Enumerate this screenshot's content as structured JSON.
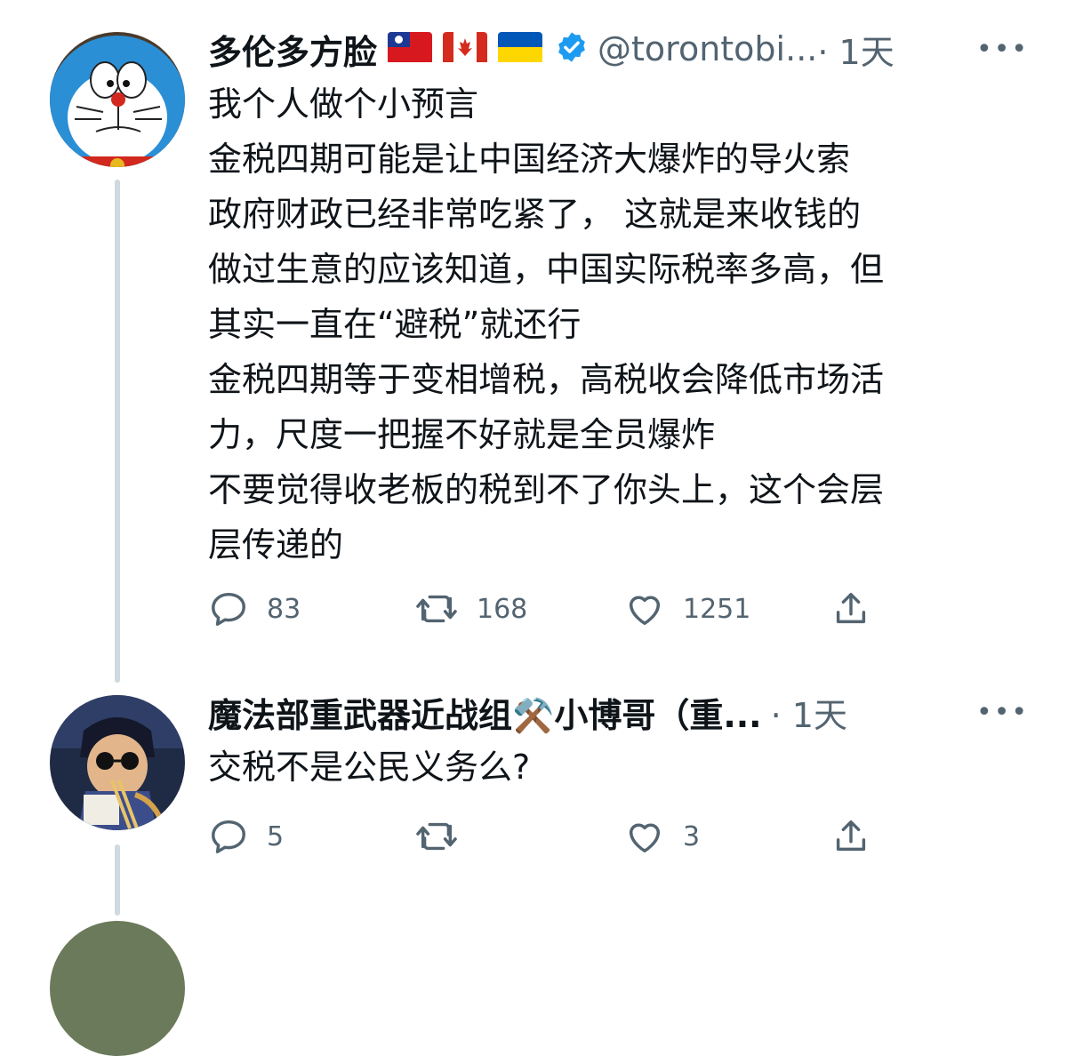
{
  "tweets": [
    {
      "author_name": "多伦多方脸",
      "flags": [
        "taiwan-flag",
        "canada-flag",
        "ukraine-flag"
      ],
      "verified": true,
      "handle": "@torontobi...",
      "time": "· 1天",
      "lines": [
        "我个人做个小预言",
        "金税四期可能是让中国经济大爆炸的导火索",
        "政府财政已经非常吃紧了， 这就是来收钱的",
        "做过生意的应该知道，中国实际税率多高，但",
        "其实一直在“避税”就还行",
        "金税四期等于变相增税，高税收会降低市场活",
        "力，尺度一把握不好就是全员爆炸",
        "不要觉得收老板的税到不了你头上，这个会层",
        "层传递的"
      ],
      "replies": "83",
      "retweets": "168",
      "likes": "1251"
    },
    {
      "author_name": "魔法部重武器近战组⚒️小博哥（重...",
      "handle": "",
      "time": "· 1天",
      "lines": [
        "交税不是公民义务么?"
      ],
      "replies": "5",
      "retweets": "",
      "likes": "3"
    }
  ],
  "more_glyph": "•••",
  "colors": {
    "text": "#0f1419",
    "secondary": "#536471",
    "verified": "#1d9bf0",
    "thread_line": "#cfd9de"
  }
}
